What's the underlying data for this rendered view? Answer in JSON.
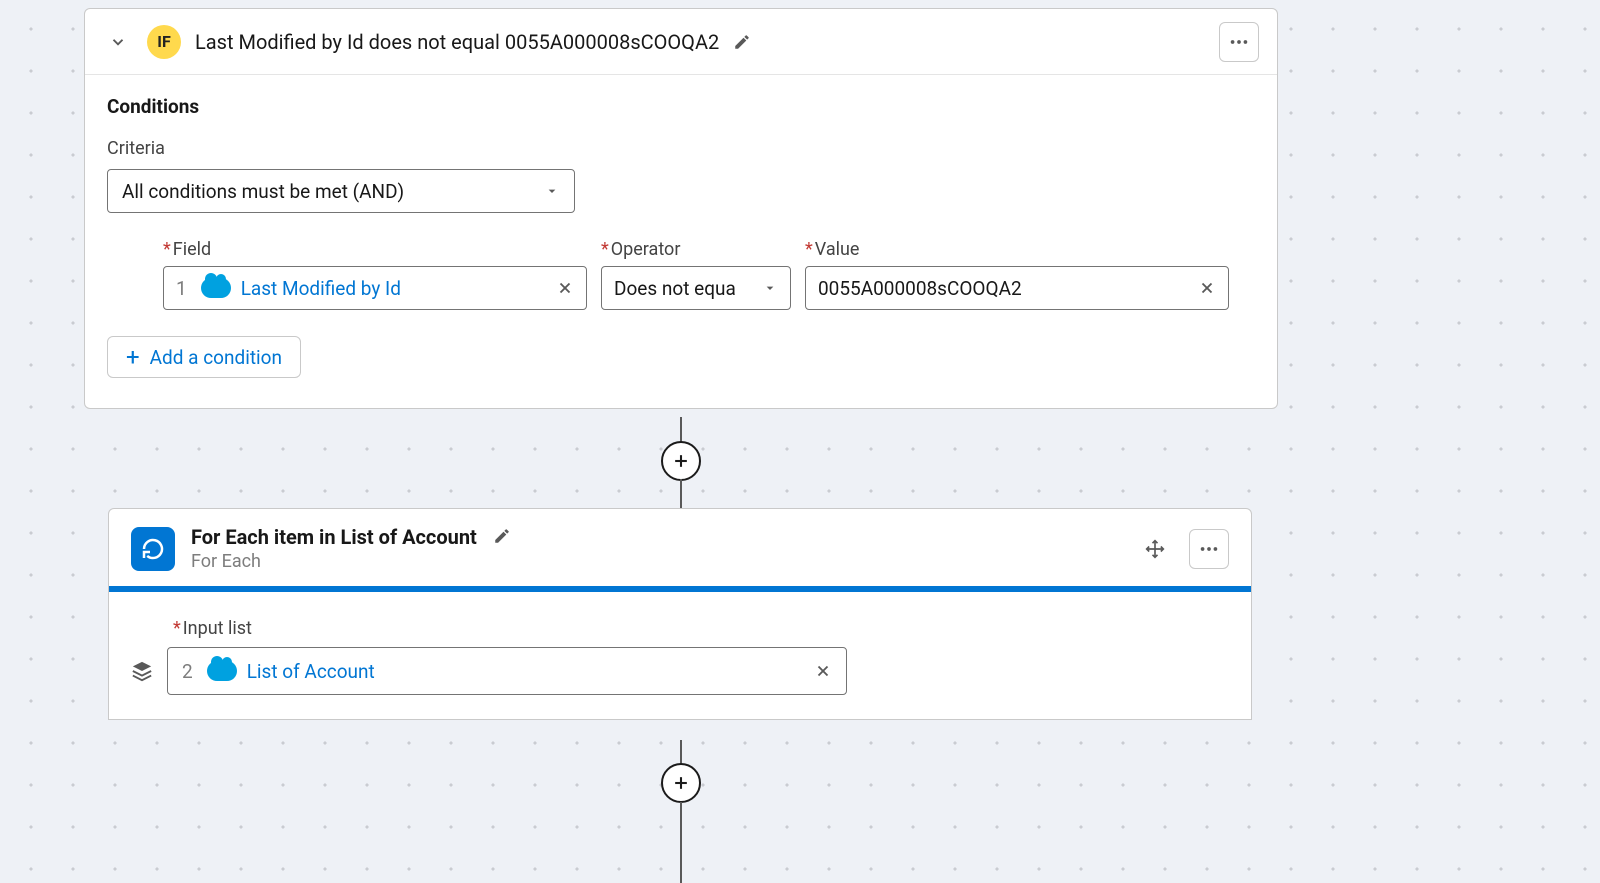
{
  "if_block": {
    "badge": "IF",
    "title": "Last Modified by Id does not equal 0055A000008sCOOQA2",
    "conditions_heading": "Conditions",
    "criteria_label": "Criteria",
    "criteria_value": "All conditions must be met (AND)",
    "row": {
      "field_label": "Field",
      "field_index": "1",
      "field_value": "Last Modified by Id",
      "operator_label": "Operator",
      "operator_value": "Does not equa",
      "value_label": "Value",
      "value_value": "0055A000008sCOOQA2"
    },
    "add_condition": "Add a condition"
  },
  "for_each": {
    "title": "For Each item in List of Account",
    "subtitle": "For Each",
    "input_list_label": "Input list",
    "input_index": "2",
    "input_value": "List of Account"
  }
}
